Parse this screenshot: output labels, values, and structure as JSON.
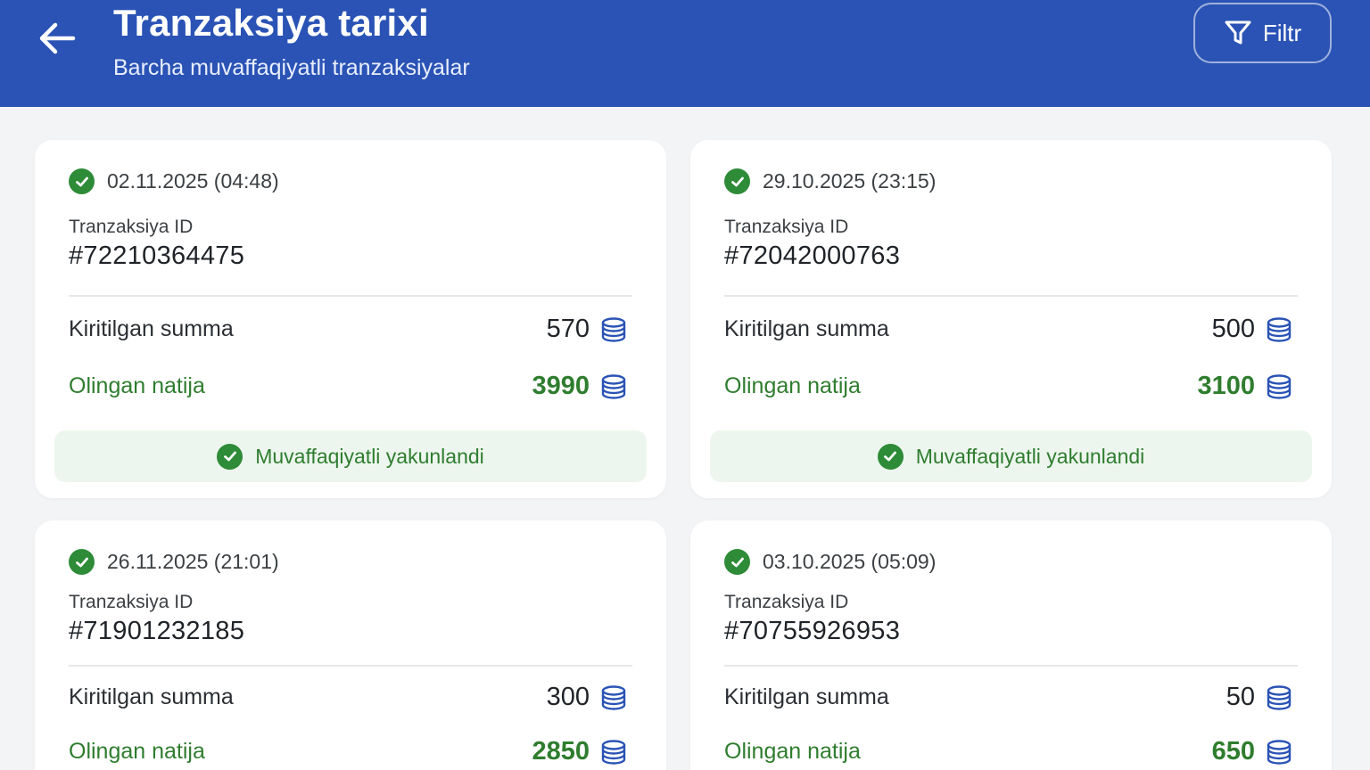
{
  "header": {
    "title": "Tranzaksiya tarixi",
    "subtitle": "Barcha muvaffaqiyatli tranzaksiyalar",
    "filter_label": "Filtr"
  },
  "labels": {
    "id_label": "Tranzaksiya ID",
    "input_label": "Kiritilgan summa",
    "result_label": "Olingan natija",
    "status_label": "Muvaffaqiyatli yakunlandi"
  },
  "colors": {
    "header_bg": "#2a53b5",
    "success_green": "#2e8b37",
    "coin_blue": "#2a53b5"
  },
  "transactions": [
    {
      "date": "02.11.2025 (04:48)",
      "id": "#72210364475",
      "input_amount": "570",
      "result_amount": "3990"
    },
    {
      "date": "29.10.2025 (23:15)",
      "id": "#72042000763",
      "input_amount": "500",
      "result_amount": "3100"
    },
    {
      "date": "26.11.2025 (21:01)",
      "id": "#71901232185",
      "input_amount": "300",
      "result_amount": "2850"
    },
    {
      "date": "03.10.2025 (05:09)",
      "id": "#70755926953",
      "input_amount": "50",
      "result_amount": "650"
    }
  ]
}
